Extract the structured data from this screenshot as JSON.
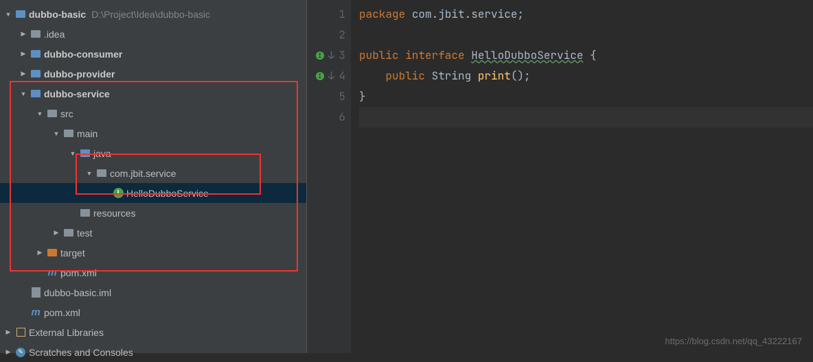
{
  "project": {
    "root": {
      "name": "dubbo-basic",
      "path": "D:\\Project\\Idea\\dubbo-basic"
    },
    "idea": ".idea",
    "consumer": "dubbo-consumer",
    "provider": "dubbo-provider",
    "service": "dubbo-service",
    "src": "src",
    "main": "main",
    "java": "java",
    "pkg": "com.jbit.service",
    "file": "HelloDubboService",
    "resources": "resources",
    "test": "test",
    "target": "target",
    "pom_service": "pom.xml",
    "iml": "dubbo-basic.iml",
    "pom_root": "pom.xml",
    "libs": "External Libraries",
    "scratches": "Scratches and Consoles"
  },
  "gutter": {
    "l1": "1",
    "l2": "2",
    "l3": "3",
    "l4": "4",
    "l5": "5",
    "l6": "6"
  },
  "code": {
    "kw_package": "package ",
    "pkg": "com.jbit.service",
    "kw_public": "public ",
    "kw_interface": "interface ",
    "cls": "HelloDubboService",
    "kw_public2": "public ",
    "typ": "String ",
    "mtd": "print",
    "brace_open": " {",
    "brace_close": "}"
  },
  "watermark": "https://blog.csdn.net/qq_43222167"
}
